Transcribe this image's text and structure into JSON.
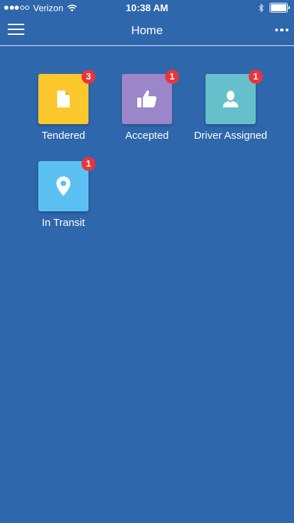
{
  "status_bar": {
    "carrier": "Verizon",
    "time": "10:38 AM",
    "signal_bars_filled": 3,
    "signal_bars_total": 5
  },
  "nav": {
    "title": "Home",
    "menu_icon": "hamburger-menu-icon",
    "more_icon": "more-dots-icon"
  },
  "tiles": [
    {
      "label": "Tendered",
      "badge": "3",
      "color": "#fdc82e",
      "icon": "document-icon"
    },
    {
      "label": "Accepted",
      "badge": "1",
      "color": "#9b86c9",
      "icon": "thumbs-up-icon"
    },
    {
      "label": "Driver Assigned",
      "badge": "1",
      "color": "#66c0cb",
      "icon": "person-icon"
    },
    {
      "label": "In Transit",
      "badge": "1",
      "color": "#5bc1f3",
      "icon": "location-pin-icon"
    }
  ],
  "colors": {
    "background": "#2f67ad",
    "badge": "#e9353a"
  }
}
